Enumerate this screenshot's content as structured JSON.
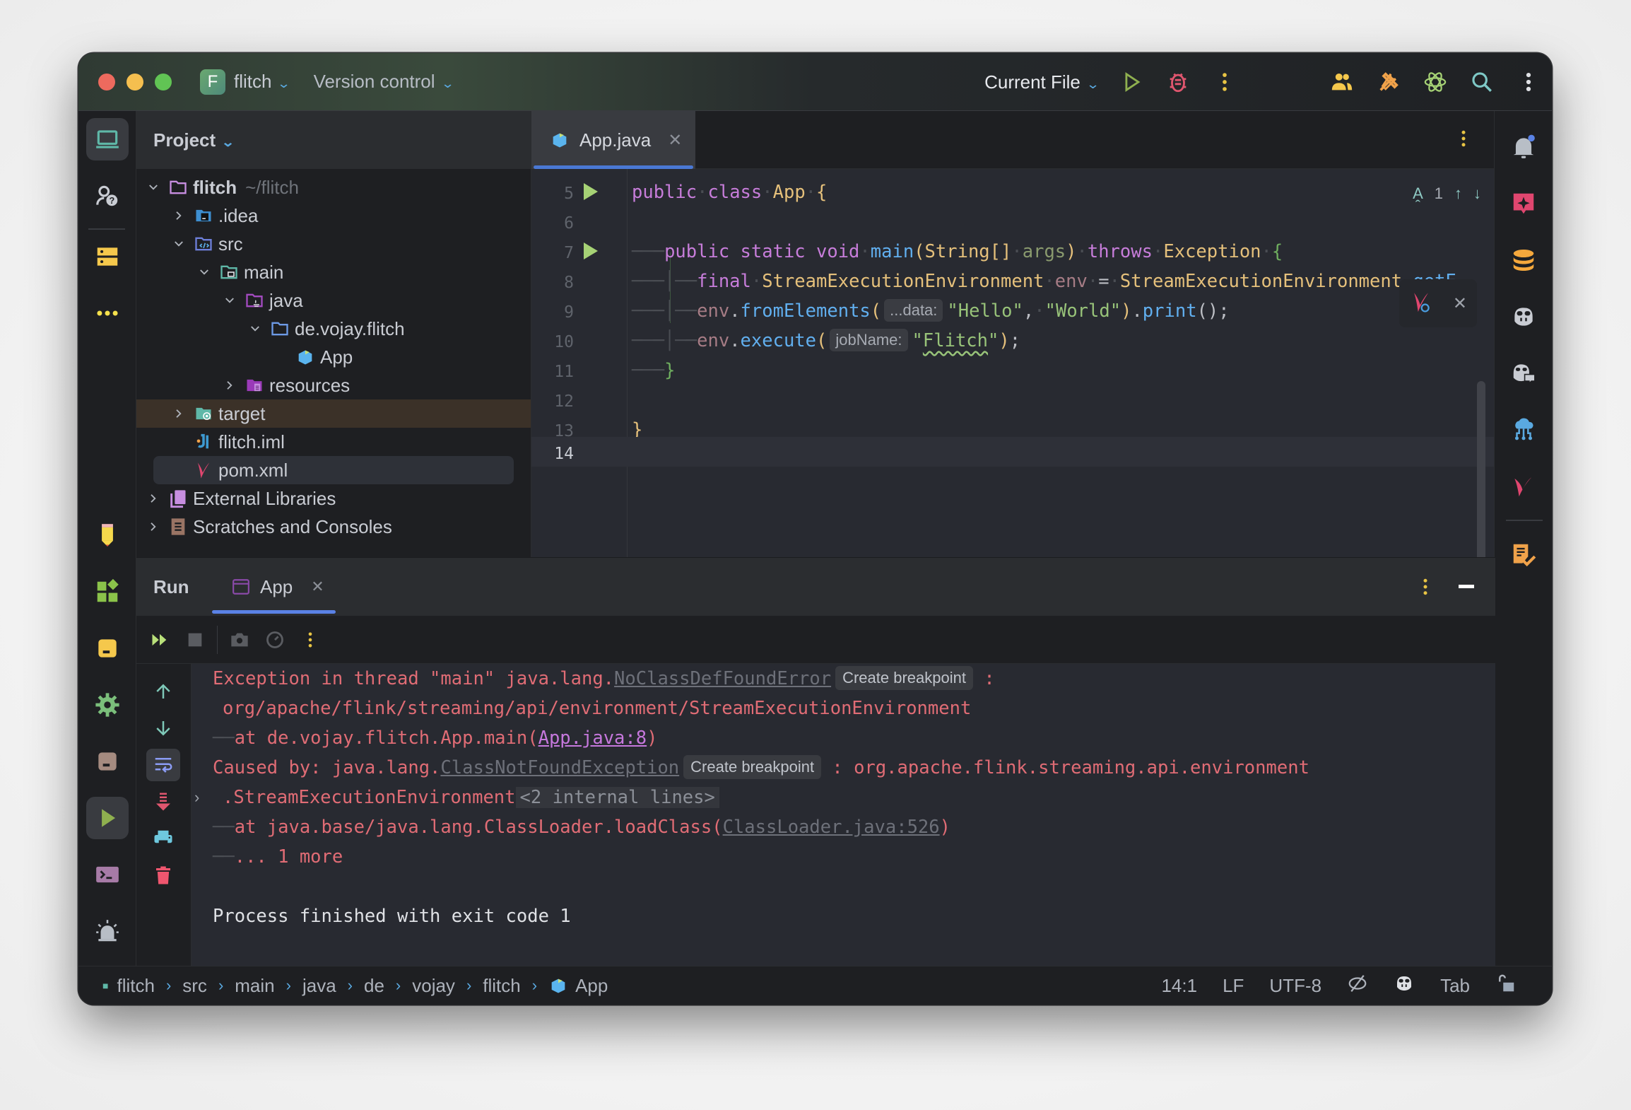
{
  "titlebar": {
    "project_initial": "F",
    "project_name": "flitch",
    "version_control": "Version control",
    "run_config": "Current File",
    "colors": {
      "close": "#ed6a5e",
      "minimize": "#f5bf4f",
      "maximize": "#61c454"
    }
  },
  "project_panel": {
    "title": "Project",
    "tree": [
      {
        "label": "flitch",
        "suffix": "~/flitch",
        "depth": 0,
        "expanded": true,
        "icon": "folder-icon"
      },
      {
        "label": ".idea",
        "depth": 1,
        "expanded": false,
        "icon": "idea-folder-icon"
      },
      {
        "label": "src",
        "depth": 1,
        "expanded": true,
        "icon": "source-folder-icon"
      },
      {
        "label": "main",
        "depth": 2,
        "expanded": true,
        "icon": "module-folder-icon"
      },
      {
        "label": "java",
        "depth": 3,
        "expanded": true,
        "icon": "java-folder-icon"
      },
      {
        "label": "de.vojay.flitch",
        "depth": 4,
        "expanded": true,
        "icon": "package-icon"
      },
      {
        "label": "App",
        "depth": 5,
        "icon": "java-class-icon"
      },
      {
        "label": "resources",
        "depth": 3,
        "expanded": false,
        "icon": "resources-folder-icon"
      },
      {
        "label": "target",
        "depth": 1,
        "expanded": false,
        "icon": "target-folder-icon"
      },
      {
        "label": "flitch.iml",
        "depth": 1,
        "icon": "iml-file-icon"
      },
      {
        "label": "pom.xml",
        "depth": 1,
        "icon": "maven-icon"
      },
      {
        "label": "External Libraries",
        "depth": 0,
        "expanded": false,
        "icon": "libraries-icon"
      },
      {
        "label": "Scratches and Consoles",
        "depth": 0,
        "expanded": false,
        "icon": "scratches-icon"
      }
    ]
  },
  "editor": {
    "tab": "App.java",
    "inspections": {
      "count": "1"
    },
    "line_numbers": [
      "5",
      "6",
      "7",
      "8",
      "9",
      "10",
      "11",
      "12",
      "13",
      "14"
    ],
    "code": {
      "l5": {
        "kw1": "public",
        "kw2": "class",
        "name": "App",
        "brace": "{"
      },
      "l7": {
        "kw": "public static void",
        "fn": "main",
        "p_open": "(",
        "type": "String[]",
        "param": "args",
        "p_close": ")",
        "kw_throws": "throws",
        "exc": "Exception",
        "brace": "{"
      },
      "l8": {
        "kw": "final",
        "type": "StreamExecutionEnvironment",
        "var": "env",
        "eq": "=",
        "type2": "StreamExecutionEnvironment",
        "dot": ".",
        "fn": "getE"
      },
      "l9": {
        "var": "env",
        "dot": ".",
        "fn": "fromElements",
        "p_open": "(",
        "hint": "...data:",
        "s1": "\"Hello\"",
        "comma": ",",
        "s2": "\"World\"",
        "p_close": ")",
        "dot2": ".",
        "fn2": "print",
        "tail": "();"
      },
      "l10": {
        "var": "env",
        "dot": ".",
        "fn": "execute",
        "p_open": "(",
        "hint": "jobName:",
        "q1": "\"",
        "s": "Flitch",
        "q2": "\"",
        "p_close": ")",
        "semi": ";"
      },
      "l11": {
        "brace": "}"
      },
      "l13": {
        "brace": "}"
      }
    },
    "cursor_line": "14"
  },
  "run_panel": {
    "title": "Run",
    "tab": "App",
    "console": {
      "l1": {
        "text": "Exception in thread \"main\" java.lang.",
        "link": "NoClassDefFoundError",
        "btn": "Create breakpoint",
        "tail": " :"
      },
      "l2": {
        "text": "org/apache/flink/streaming/api/environment/StreamExecutionEnvironment"
      },
      "l3": {
        "prefix": "at de.vojay.flitch.App.main(",
        "link": "App.java:8",
        "tail": ")"
      },
      "l4": {
        "text": "Caused by: java.lang.",
        "link": "ClassNotFoundException",
        "btn": "Create breakpoint",
        "tail": " : org.apache.flink.streaming.api.environment"
      },
      "l5": {
        "text": ".StreamExecutionEnvironment",
        "internal": "<2 internal lines>"
      },
      "l6": {
        "prefix": "at java.base/java.lang.ClassLoader.loadClass(",
        "link": "ClassLoader.java:526",
        "tail": ")"
      },
      "l7": {
        "text": "... 1 more"
      },
      "l8": {
        "text": "Process finished with exit code 1"
      }
    }
  },
  "status_bar": {
    "breadcrumbs": [
      "flitch",
      "src",
      "main",
      "java",
      "de",
      "vojay",
      "flitch",
      "App"
    ],
    "position": "14:1",
    "line_ending": "LF",
    "encoding": "UTF-8",
    "indent": "Tab"
  }
}
